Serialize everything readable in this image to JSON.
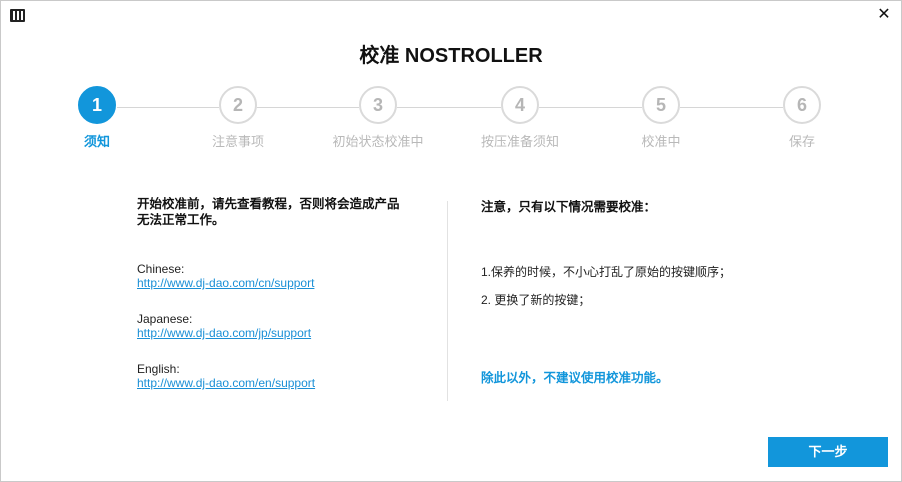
{
  "window": {
    "title": "校准 NOSTROLLER",
    "app_icon": "piano-keyboard-icon",
    "close_glyph": "✕"
  },
  "steps": [
    {
      "number": "1",
      "label": "须知",
      "active": true
    },
    {
      "number": "2",
      "label": "注意事项",
      "active": false
    },
    {
      "number": "3",
      "label": "初始状态校准中",
      "active": false
    },
    {
      "number": "4",
      "label": "按压准备须知",
      "active": false
    },
    {
      "number": "5",
      "label": "校准中",
      "active": false
    },
    {
      "number": "6",
      "label": "保存",
      "active": false
    }
  ],
  "left": {
    "warning_line1": "开始校准前，请先查看教程，否则将会造成产品",
    "warning_line2": "无法正常工作。",
    "links": [
      {
        "lang": "Chinese:",
        "url": "http://www.dj-dao.com/cn/support"
      },
      {
        "lang": "Japanese:",
        "url": "http://www.dj-dao.com/jp/support"
      },
      {
        "lang": "English:",
        "url": "http://www.dj-dao.com/en/support"
      }
    ]
  },
  "right": {
    "heading": "注意，只有以下情况需要校准：",
    "items": [
      "1.保养的时候，不小心打乱了原始的按键顺序；",
      "2. 更换了新的按键；"
    ],
    "footer": "除此以外，不建议使用校准功能。"
  },
  "buttons": {
    "next_label": "下一步"
  },
  "colors": {
    "accent": "#1296db",
    "inactive_step": "#dadada",
    "link": "#1a8fd6"
  }
}
